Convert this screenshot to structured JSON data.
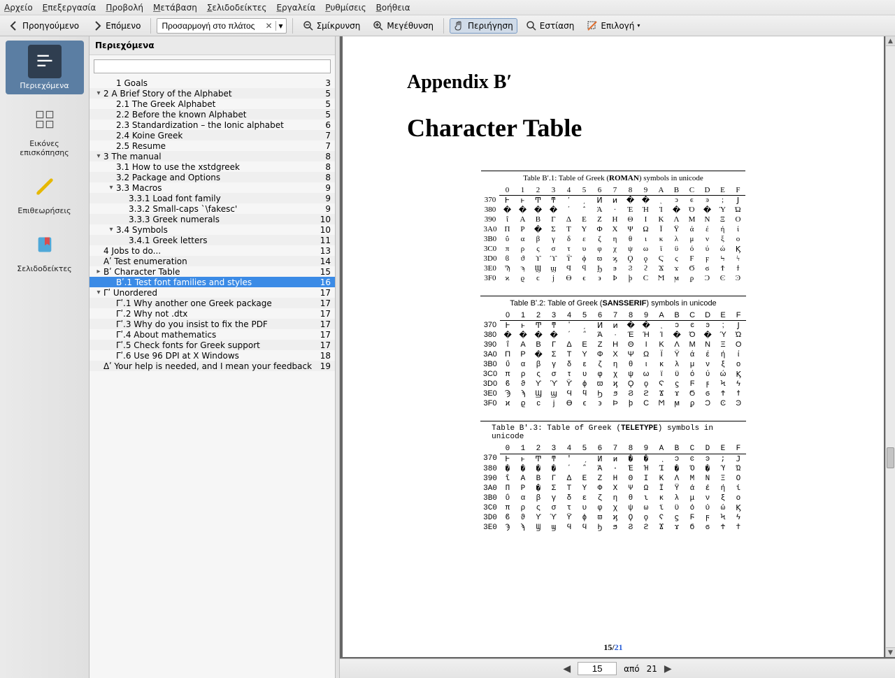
{
  "menubar": [
    "Αρχείο",
    "Επεξεργασία",
    "Προβολή",
    "Μετάβαση",
    "Σελιδοδείκτες",
    "Εργαλεία",
    "Ρυθμίσεις",
    "Βοήθεια"
  ],
  "toolbar": {
    "prev": "Προηγούμενο",
    "next": "Επόμενο",
    "zoom_value": "Προσαρμογή στο πλάτος",
    "zoom_out": "Σμίκρυνση",
    "zoom_in": "Μεγέθυνση",
    "browse": "Περιήγηση",
    "focus": "Εστίαση",
    "select": "Επιλογή"
  },
  "sidebar": {
    "items": [
      {
        "label": "Περιεχόμενα",
        "icon": "toc-icon",
        "active": true
      },
      {
        "label": "Εικόνες επισκόπησης",
        "icon": "thumbnails-icon"
      },
      {
        "label": "Επιθεωρήσεις",
        "icon": "reviews-icon"
      },
      {
        "label": "Σελιδοδείκτες",
        "icon": "bookmarks-icon"
      }
    ]
  },
  "index": {
    "title": "Περιεχόμενα",
    "search_placeholder": "",
    "rows": [
      {
        "d": 2,
        "e": "",
        "t": "1 Goals",
        "p": "3"
      },
      {
        "d": 1,
        "e": "v",
        "t": "2 A Brief Story of the Alphabet",
        "p": "5"
      },
      {
        "d": 2,
        "e": "",
        "t": "2.1 The Greek Alphabet",
        "p": "5"
      },
      {
        "d": 2,
        "e": "",
        "t": "2.2 Before the known Alphabet",
        "p": "5"
      },
      {
        "d": 2,
        "e": "",
        "t": "2.3 Standardization – the Ionic alphabet",
        "p": "6"
      },
      {
        "d": 2,
        "e": "",
        "t": "2.4 Koine Greek",
        "p": "7"
      },
      {
        "d": 2,
        "e": "",
        "t": "2.5 Resume",
        "p": "7"
      },
      {
        "d": 1,
        "e": "v",
        "t": "3 The manual",
        "p": "8"
      },
      {
        "d": 2,
        "e": "",
        "t": "3.1 How to use the xstdgreek",
        "p": "8"
      },
      {
        "d": 2,
        "e": "",
        "t": "3.2 Package and Options",
        "p": "8"
      },
      {
        "d": 2,
        "e": "v",
        "t": "3.3 Macros",
        "p": "9"
      },
      {
        "d": 3,
        "e": "",
        "t": "3.3.1 Load font family",
        "p": "9"
      },
      {
        "d": 3,
        "e": "",
        "t": "3.3.2 Small-caps `\\fakesc'",
        "p": "9"
      },
      {
        "d": 3,
        "e": "",
        "t": "3.3.3 Greek numerals",
        "p": "10"
      },
      {
        "d": 2,
        "e": "v",
        "t": "3.4 Symbols",
        "p": "10"
      },
      {
        "d": 3,
        "e": "",
        "t": "3.4.1 Greek letters",
        "p": "11"
      },
      {
        "d": 1,
        "e": "",
        "t": "4 Jobs to do...",
        "p": "13"
      },
      {
        "d": 1,
        "e": "",
        "t": "Αʹ Test enumeration",
        "p": "14"
      },
      {
        "d": 1,
        "e": ">",
        "t": "Βʹ Character Table",
        "p": "15"
      },
      {
        "d": 2,
        "e": "",
        "t": "Βʹ.1 Test font families and styles",
        "p": "16",
        "sel": true
      },
      {
        "d": 1,
        "e": "v",
        "t": "Γʹ Unordered",
        "p": "17"
      },
      {
        "d": 2,
        "e": "",
        "t": "Γʹ.1 Why another one Greek package",
        "p": "17"
      },
      {
        "d": 2,
        "e": "",
        "t": "Γʹ.2 Why not .dtx",
        "p": "17"
      },
      {
        "d": 2,
        "e": "",
        "t": "Γʹ.3 Why do you insist to fix the PDF",
        "p": "17"
      },
      {
        "d": 2,
        "e": "",
        "t": "Γʹ.4 About mathematics",
        "p": "17"
      },
      {
        "d": 2,
        "e": "",
        "t": "Γʹ.5 Check fonts for Greek support",
        "p": "17"
      },
      {
        "d": 2,
        "e": "",
        "t": "Γʹ.6 Use 96 DPI at X Windows",
        "p": "18"
      },
      {
        "d": 1,
        "e": "",
        "t": "Δʹ Your help is needed, and I mean your feedback",
        "p": "19"
      }
    ]
  },
  "doc": {
    "h1": "Appendix Bʹ",
    "h2": "Character Table",
    "caption1_pre": "Table Bʹ.1: Table of Greek (",
    "caption1_b": "ROMAN",
    "caption1_post": ") symbols in unicode",
    "caption2_pre": "Table Bʹ.2: Table of Greek (",
    "caption2_b": "SANSSERIF",
    "caption2_post": ") symbols in unicode",
    "caption3_pre": "Table Bʹ.3: Table of Greek (",
    "caption3_b": "TELETYPE",
    "caption3_post": ") symbols in unicode",
    "cols": [
      "",
      "0",
      "1",
      "2",
      "3",
      "4",
      "5",
      "6",
      "7",
      "8",
      "9",
      "A",
      "B",
      "C",
      "D",
      "E",
      "F"
    ],
    "rowlabels": [
      "370",
      "380",
      "390",
      "3A0",
      "3B0",
      "3C0",
      "3D0",
      "3E0",
      "3F0"
    ],
    "rowlabels3": [
      "370",
      "380",
      "390",
      "3A0",
      "3B0",
      "3C0",
      "3D0",
      "3E0"
    ],
    "grid": [
      [
        "Ͱ",
        "ͱ",
        "Ͳ",
        "ͳ",
        "ʹ",
        "͵",
        "Ͷ",
        "ͷ",
        "�",
        "�",
        "ͺ",
        "ͻ",
        "ͼ",
        "ͽ",
        ";",
        "Ϳ"
      ],
      [
        "�",
        "�",
        "�",
        "�",
        "΄",
        "΅",
        "Ά",
        "·",
        "Έ",
        "Ή",
        "Ί",
        "�",
        "Ό",
        "�",
        "Ύ",
        "Ώ"
      ],
      [
        "ΐ",
        "Α",
        "Β",
        "Γ",
        "Δ",
        "Ε",
        "Ζ",
        "Η",
        "Θ",
        "Ι",
        "Κ",
        "Λ",
        "Μ",
        "Ν",
        "Ξ",
        "Ο"
      ],
      [
        "Π",
        "Ρ",
        "�",
        "Σ",
        "Τ",
        "Υ",
        "Φ",
        "Χ",
        "Ψ",
        "Ω",
        "Ϊ",
        "Ϋ",
        "ά",
        "έ",
        "ή",
        "ί"
      ],
      [
        "ΰ",
        "α",
        "β",
        "γ",
        "δ",
        "ε",
        "ζ",
        "η",
        "θ",
        "ι",
        "κ",
        "λ",
        "μ",
        "ν",
        "ξ",
        "ο"
      ],
      [
        "π",
        "ρ",
        "ς",
        "σ",
        "τ",
        "υ",
        "φ",
        "χ",
        "ψ",
        "ω",
        "ϊ",
        "ϋ",
        "ό",
        "ύ",
        "ώ",
        "Ϗ"
      ],
      [
        "ϐ",
        "ϑ",
        "ϒ",
        "ϓ",
        "ϔ",
        "ϕ",
        "ϖ",
        "ϗ",
        "Ϙ",
        "ϙ",
        "Ϛ",
        "ϛ",
        "Ϝ",
        "ϝ",
        "Ϟ",
        "ϟ"
      ],
      [
        "Ϡ",
        "ϡ",
        "Ϣ",
        "ϣ",
        "Ϥ",
        "ϥ",
        "Ϧ",
        "ϧ",
        "Ϩ",
        "ϩ",
        "Ϫ",
        "ϫ",
        "Ϭ",
        "ϭ",
        "Ϯ",
        "ϯ"
      ],
      [
        "ϰ",
        "ϱ",
        "ϲ",
        "ϳ",
        "ϴ",
        "ϵ",
        "϶",
        "Ϸ",
        "ϸ",
        "Ϲ",
        "Ϻ",
        "ϻ",
        "ϼ",
        "Ͻ",
        "Ͼ",
        "Ͽ"
      ]
    ],
    "page_current": "15",
    "page_total": "21",
    "page_sep": "/"
  },
  "pager": {
    "of": "από",
    "current": "15",
    "total": "21"
  }
}
